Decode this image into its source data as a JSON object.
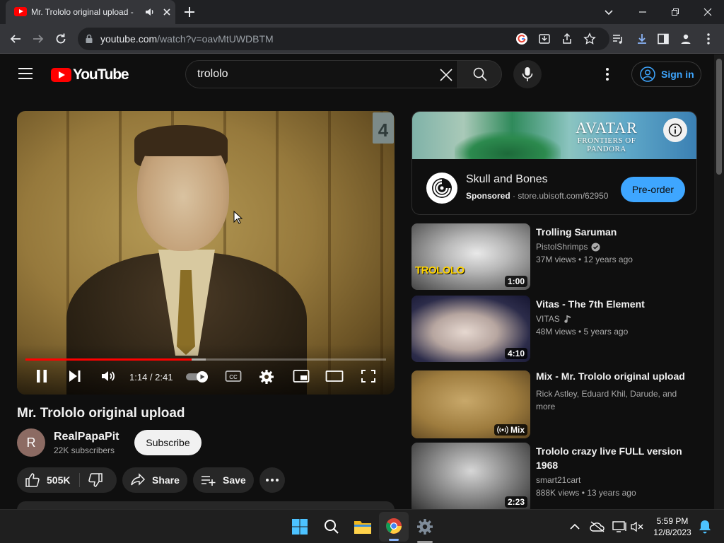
{
  "browser": {
    "tab_title": "Mr. Trololo original upload -",
    "url_host": "youtube.com",
    "url_path": "/watch?v=oavMtUWDBTM"
  },
  "header": {
    "logo_text": "YouTube",
    "search_query": "trololo",
    "signin_label": "Sign in"
  },
  "player": {
    "channel_bug": "4",
    "time_display": "1:14 / 2:41",
    "progress_fraction": 0.46,
    "buffered_fraction": 0.5
  },
  "video": {
    "title": "Mr. Trololo original upload",
    "channel_initial": "R",
    "channel_name": "RealPapaPit",
    "subscribers": "22K subscribers",
    "subscribe_label": "Subscribe",
    "likes": "505K",
    "share_label": "Share",
    "save_label": "Save"
  },
  "ad": {
    "banner_title": "AVATAR",
    "banner_subtitle": "FRONTIERS OF PANDORA",
    "name": "Skull and Bones",
    "sponsored": "Sponsored",
    "domain": "store.ubisoft.com/62950",
    "cta": "Pre-order"
  },
  "recommendations": [
    {
      "title": "Trolling Saruman",
      "channel": "PistolShrimps",
      "verified": true,
      "meta": "37M views  • 12 years ago",
      "duration": "1:00",
      "thumb_text": "TROLOLO"
    },
    {
      "title": "Vitas - The 7th Element",
      "channel": "VITAS",
      "music": true,
      "meta": "48M views  • 5 years ago",
      "duration": "4:10"
    },
    {
      "title": "Mix - Mr. Trololo original upload",
      "channel": "Rick Astley, Eduard Khil, Darude, and",
      "channel_line2": "more",
      "duration": "Mix"
    },
    {
      "title": "Trololo crazy live FULL version",
      "title_line2": "1968",
      "channel": "smart21cart",
      "meta": "888K views  • 13 years ago",
      "duration": "2:23"
    }
  ],
  "taskbar": {
    "time": "5:59 PM",
    "date": "12/8/2023"
  },
  "colors": {
    "yt_red": "#ff0000",
    "link_blue": "#3ea6ff",
    "background": "#0f0f0f"
  }
}
